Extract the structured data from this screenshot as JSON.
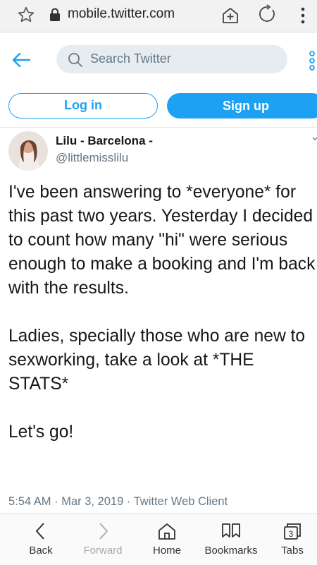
{
  "browser": {
    "url": "mobile.twitter.com"
  },
  "header": {
    "search_placeholder": "Search Twitter",
    "login_label": "Log in",
    "signup_label": "Sign up"
  },
  "tweet": {
    "author_name": "Lilu - Barcelona -",
    "author_handle": "@littlemisslilu",
    "text": "I've been answering to *everyone* for this past two years. Yesterday I decided to count how many \"hi\" were serious enough to make a booking and I'm back with the results.\n\nLadies, specially those who are new to sexworking, take a look at *THE STATS*\n\nLet's go!",
    "meta": "5:54 AM · Mar 3, 2019 · Twitter Web Client"
  },
  "bottom_nav": {
    "back": "Back",
    "forward": "Forward",
    "home": "Home",
    "bookmarks": "Bookmarks",
    "tabs": "Tabs",
    "tab_count": "3"
  },
  "colors": {
    "accent": "#1da1f2",
    "muted": "#657786"
  }
}
